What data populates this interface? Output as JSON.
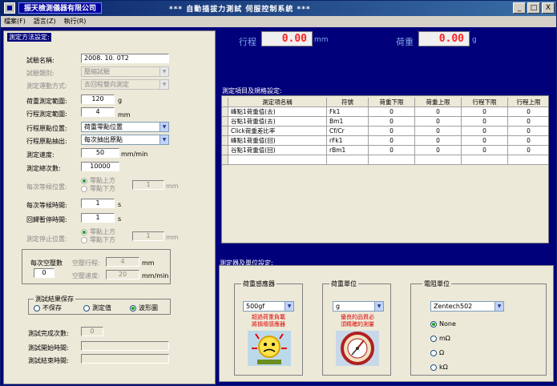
{
  "window": {
    "company": "振天檢測儀器有限公司",
    "title": "***  自動插拔力測試   伺服控制系統  ***",
    "min_label": "_",
    "max_label": "□",
    "close_label": "X"
  },
  "menu": [
    "檔案(F)",
    "語言(Z)",
    "執行(R)"
  ],
  "left": {
    "title": "測定方法設定:",
    "test_name_label": "試驗名稱:",
    "test_name_value": "2008. 10. 0T2",
    "test_type_label": "試驗類別:",
    "test_type_value": "壓縮試驗",
    "motion_label": "測定運動方式:",
    "motion_value": "去回程雙向測定",
    "load_range_label": "荷重測定範圍:",
    "load_range_value": "120",
    "load_range_unit": "g",
    "stroke_range_label": "行程測定範圍:",
    "stroke_range_value": "4",
    "stroke_range_unit": "mm",
    "zero_pos_label": "行程原點位置:",
    "zero_pos_value": "荷重零點位置",
    "zero_find_label": "行程原點抽出:",
    "zero_find_value": "每次抽出原點",
    "speed_label": "測定速度:",
    "speed_value": "50",
    "speed_unit": "mm/min",
    "total_label": "測定總次數:",
    "total_value": "10000",
    "wait_pos_label": "每次等候位置:",
    "wait_above": "零點上方",
    "wait_below": "零點下方",
    "wait_value": "1",
    "wait_unit": "mm",
    "wait_time_label": "每次等候時間:",
    "wait_time_value": "1",
    "wait_time_unit": "s",
    "return_label": "回歸暫停時間:",
    "return_value": "1",
    "return_unit": "s",
    "stop_pos_label": "測定停止位置:",
    "stop_above": "零點上方",
    "stop_below": "零點下方",
    "stop_value": "1",
    "stop_unit": "mm",
    "idle_count_label": "每次空壓數",
    "idle_count_value": "0",
    "idle_stroke_label": "空壓行程:",
    "idle_stroke_value": "4",
    "idle_stroke_unit": "mm",
    "idle_speed_label": "空壓速度:",
    "idle_speed_value": "20",
    "idle_speed_unit": "mm/min",
    "save_group": "測試結果保存",
    "save_none": "不保存",
    "save_value": "測定值",
    "save_wave": "波形圖",
    "done_label": "測試完成次數:",
    "done_value": "0",
    "start_label": "測試開始時間:",
    "end_label": "測試結束時間:"
  },
  "readouts": {
    "stroke_label": "行程",
    "stroke_value": "0.00",
    "stroke_unit": "mm",
    "load_label": "荷重",
    "load_value": "0.00",
    "load_unit": "g"
  },
  "table": {
    "section": "測定項目及規格設定:",
    "headers": [
      "測定項名稱",
      "符號",
      "荷重下限",
      "荷重上限",
      "行程下限",
      "行程上限"
    ],
    "rows": [
      [
        "峰點1荷重值(去)",
        "Fk1",
        "0",
        "0",
        "0",
        "0"
      ],
      [
        "谷點1荷重值(去)",
        "Bm1",
        "0",
        "0",
        "0",
        "0"
      ],
      [
        "Click荷重差比率",
        "Cf/Cr",
        "0",
        "0",
        "0",
        "0"
      ],
      [
        "峰點1荷重值(回)",
        "rFk1",
        "0",
        "0",
        "0",
        "0"
      ],
      [
        "谷點1荷重值(回)",
        "rBm1",
        "0",
        "0",
        "0",
        "0"
      ]
    ]
  },
  "sensor": {
    "section": "測定器及單位設定:",
    "sensor_group": "荷重感應器",
    "sensor_value": "500gf",
    "sensor_warn_1": "超過荷重負載",
    "sensor_warn_2": "將損壞感應器",
    "unit_group": "荷重單位",
    "unit_value": "g",
    "unit_warn_1": "優良的品質必",
    "unit_warn_2": "須精確的測量",
    "res_group": "電阻單位",
    "res_value": "Zentech502",
    "res_options": [
      "None",
      "mΩ",
      "Ω",
      "kΩ"
    ]
  }
}
